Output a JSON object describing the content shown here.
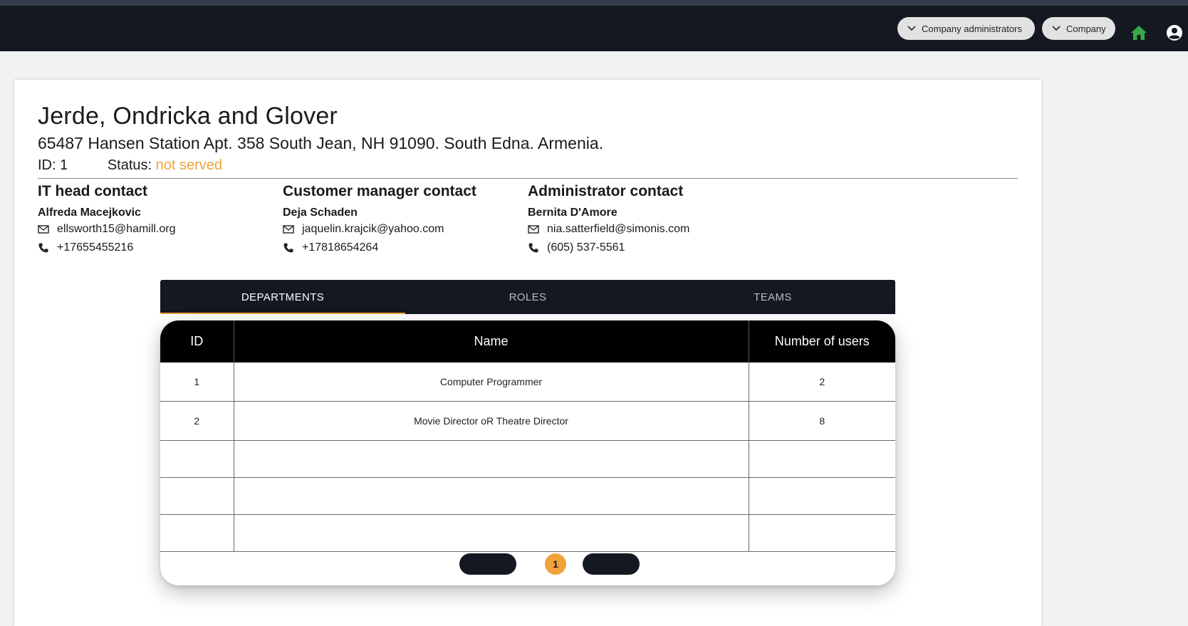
{
  "header": {
    "dropdowns": [
      {
        "label": "Company administrators",
        "icon": "chevron-down-icon"
      },
      {
        "label": "Company",
        "icon": "chevron-down-icon"
      }
    ],
    "home_icon": "home-icon",
    "account_icon": "account-circle-icon"
  },
  "company": {
    "name": "Jerde, Ondricka and Glover",
    "address": "65487 Hansen Station Apt. 358 South Jean, NH 91090. South Edna. Armenia.",
    "id_label": "ID:",
    "id_value": "1",
    "status_label": "Status:",
    "status_value": "not served"
  },
  "contacts": [
    {
      "title": "IT head contact",
      "name": "Alfreda Macejkovic",
      "email": "ellsworth15@hamill.org",
      "phone": "+17655455216"
    },
    {
      "title": "Customer manager contact",
      "name": "Deja Schaden",
      "email": "jaquelin.krajcik@yahoo.com",
      "phone": "+17818654264"
    },
    {
      "title": "Administrator contact",
      "name": "Bernita D'Amore",
      "email": "nia.satterfield@simonis.com",
      "phone": "(605) 537-5561"
    }
  ],
  "tabs": [
    {
      "label": "DEPARTMENTS",
      "active": true
    },
    {
      "label": "ROLES",
      "active": false
    },
    {
      "label": "TEAMS",
      "active": false
    }
  ],
  "table": {
    "columns": [
      "ID",
      "Name",
      "Number of users"
    ],
    "rows": [
      {
        "id": "1",
        "name": "Computer Programmer",
        "users": "2"
      },
      {
        "id": "2",
        "name": "Movie Director oR Theatre Director",
        "users": "8"
      }
    ]
  },
  "pagination": {
    "current_page": "1"
  },
  "colors": {
    "accent": "#f0a33b",
    "navbar": "#141820",
    "home_icon": "#3aa84a"
  }
}
